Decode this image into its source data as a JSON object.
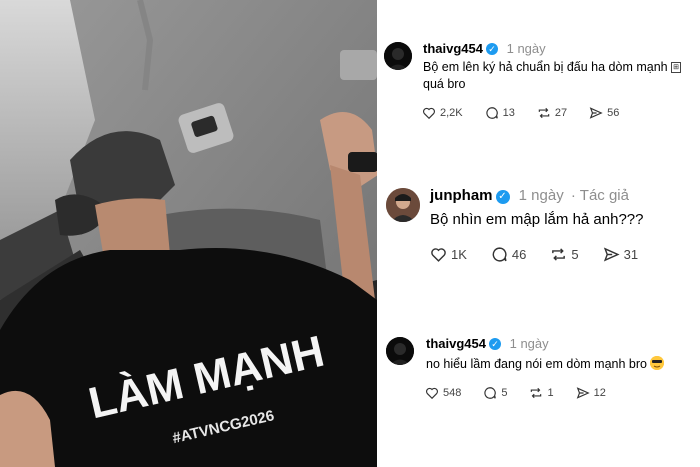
{
  "photo": {
    "shirt_line1": "LÀM MẠNH",
    "shirt_hashtag": "#ATVNCG2026"
  },
  "posts": [
    {
      "username": "thaivg454",
      "time": "1 ngày",
      "author_tag": "",
      "text_main": "Bộ em lên ký hả chuẩn bị đấu ha dòm mạnh",
      "text_glyph": "⊞",
      "text_tail": "quá bro",
      "likes": "2,2K",
      "comments": "13",
      "reposts": "27",
      "shares": "56"
    },
    {
      "username": "junpham",
      "time": "1 ngày",
      "author_tag": "· Tác giả",
      "text_main": "Bộ nhìn em mập lắm hả anh???",
      "likes": "1K",
      "comments": "46",
      "reposts": "5",
      "shares": "31"
    },
    {
      "username": "thaivg454",
      "time": "1 ngày",
      "author_tag": "",
      "text_main": "no hiểu lầm đang nói em dòm mạnh bro",
      "likes": "548",
      "comments": "5",
      "reposts": "1",
      "shares": "12"
    }
  ],
  "icons": {
    "verified": "verified-badge-icon",
    "like": "heart-icon",
    "comment": "comment-bubble-icon",
    "repost": "repost-icon",
    "share": "send-icon",
    "emoji": "cool-face-emoji-icon"
  },
  "colors": {
    "verified": "#1d9bf0",
    "meta": "#8e8e8e"
  }
}
